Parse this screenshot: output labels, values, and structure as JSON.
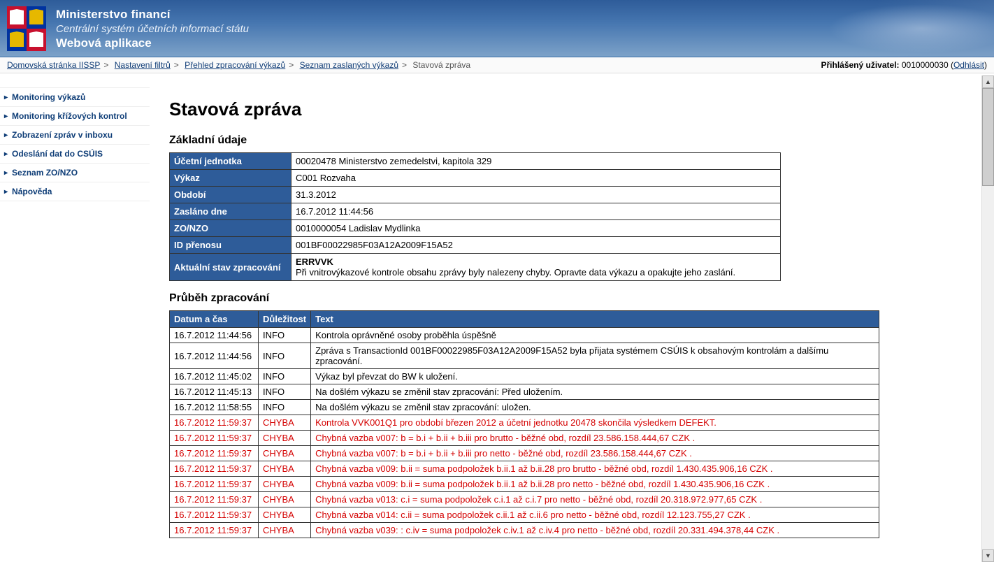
{
  "header": {
    "ministry": "Ministerstvo financí",
    "system": "Centrální systém účetních informací státu",
    "app": "Webová aplikace"
  },
  "breadcrumbs": {
    "items": [
      "Domovská stránka IISSP",
      "Nastavení filtrů",
      "Přehled zpracování výkazů",
      "Seznam zaslaných výkazů"
    ],
    "current": "Stavová zpráva"
  },
  "user": {
    "label": "Přihlášený uživatel:",
    "id": "0010000030",
    "logout": "Odhlásit"
  },
  "sidebar": {
    "items": [
      "Monitoring výkazů",
      "Monitoring křížových kontrol",
      "Zobrazení zpráv v inboxu",
      "Odeslání dat do CSÚIS",
      "Seznam ZO/NZO",
      "Nápověda"
    ]
  },
  "page": {
    "title": "Stavová zpráva",
    "section_basic": "Základní údaje",
    "section_progress": "Průběh zpracování"
  },
  "basic": {
    "rows": [
      {
        "label": "Účetní jednotka",
        "value": "00020478 Ministerstvo zemedelstvi, kapitola 329"
      },
      {
        "label": "Výkaz",
        "value": "C001 Rozvaha"
      },
      {
        "label": "Období",
        "value": "31.3.2012"
      },
      {
        "label": "Zasláno dne",
        "value": "16.7.2012 11:44:56"
      },
      {
        "label": "ZO/NZO",
        "value": "0010000054 Ladislav Mydlinka"
      },
      {
        "label": "ID přenosu",
        "value": "001BF00022985F03A12A2009F15A52"
      },
      {
        "label": "Aktuální stav zpracování",
        "value": "ERRVVK\nPři vnitrovýkazové kontrole obsahu zprávy byly nalezeny chyby. Opravte data výkazu a opakujte jeho zaslání."
      }
    ]
  },
  "log": {
    "headers": {
      "datetime": "Datum a čas",
      "severity": "Důležitost",
      "text": "Text"
    },
    "rows": [
      {
        "datetime": "16.7.2012 11:44:56",
        "severity": "INFO",
        "text": "Kontrola oprávněné osoby proběhla úspěšně",
        "error": false
      },
      {
        "datetime": "16.7.2012 11:44:56",
        "severity": "INFO",
        "text": "Zpráva s TransactionId 001BF00022985F03A12A2009F15A52 byla přijata systémem CSÚIS k obsahovým kontrolám a dalšímu zpracování.",
        "error": false
      },
      {
        "datetime": "16.7.2012 11:45:02",
        "severity": "INFO",
        "text": "Výkaz byl převzat do BW k uložení.",
        "error": false
      },
      {
        "datetime": "16.7.2012 11:45:13",
        "severity": "INFO",
        "text": "Na došlém výkazu se změnil stav zpracování: Před uložením.",
        "error": false
      },
      {
        "datetime": "16.7.2012 11:58:55",
        "severity": "INFO",
        "text": "Na došlém výkazu se změnil stav zpracování: uložen.",
        "error": false
      },
      {
        "datetime": "16.7.2012 11:59:37",
        "severity": "CHYBA",
        "text": "Kontrola VVK001Q1 pro období březen 2012 a účetní jednotku 20478 skončila výsledkem DEFEKT.",
        "error": true
      },
      {
        "datetime": "16.7.2012 11:59:37",
        "severity": "CHYBA",
        "text": "Chybná vazba v007: b = b.i + b.ii + b.iii pro brutto - běžné obd, rozdíl 23.586.158.444,67 CZK .",
        "error": true
      },
      {
        "datetime": "16.7.2012 11:59:37",
        "severity": "CHYBA",
        "text": "Chybná vazba v007: b = b.i + b.ii + b.iii pro netto - běžné obd, rozdíl 23.586.158.444,67 CZK .",
        "error": true
      },
      {
        "datetime": "16.7.2012 11:59:37",
        "severity": "CHYBA",
        "text": "Chybná vazba v009: b.ii = suma podpoložek b.ii.1 až b.ii.28 pro brutto - běžné obd, rozdíl 1.430.435.906,16 CZK .",
        "error": true
      },
      {
        "datetime": "16.7.2012 11:59:37",
        "severity": "CHYBA",
        "text": "Chybná vazba v009: b.ii = suma podpoložek b.ii.1 až b.ii.28 pro netto - běžné obd, rozdíl 1.430.435.906,16 CZK .",
        "error": true
      },
      {
        "datetime": "16.7.2012 11:59:37",
        "severity": "CHYBA",
        "text": "Chybná vazba v013: c.i = suma podpoložek c.i.1 až c.i.7 pro netto - běžné obd, rozdíl 20.318.972.977,65 CZK .",
        "error": true
      },
      {
        "datetime": "16.7.2012 11:59:37",
        "severity": "CHYBA",
        "text": "Chybná vazba v014: c.ii = suma podpoložek c.ii.1 až c.ii.6 pro netto - běžné obd, rozdíl 12.123.755,27 CZK .",
        "error": true
      },
      {
        "datetime": "16.7.2012 11:59:37",
        "severity": "CHYBA",
        "text": "Chybná vazba v039: : c.iv = suma podpoložek c.iv.1 až c.iv.4 pro netto - běžné obd, rozdíl 20.331.494.378,44 CZK .",
        "error": true
      }
    ]
  }
}
